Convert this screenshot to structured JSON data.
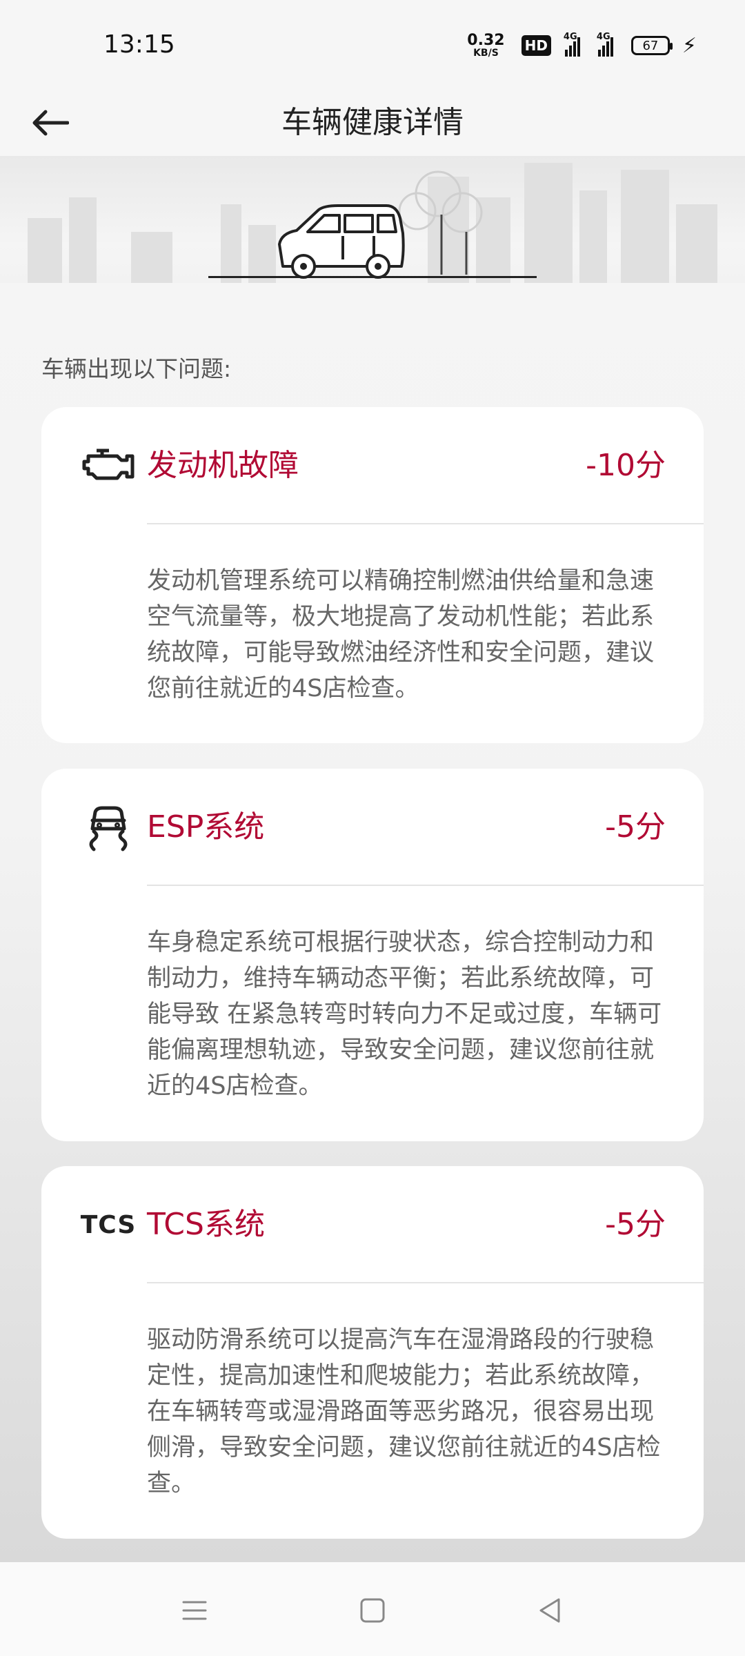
{
  "status_bar": {
    "time": "13:15",
    "net_speed": "0.32",
    "net_unit": "KB/S",
    "hd_label": "HD",
    "signal1_label": "4G",
    "signal2_label": "4G",
    "battery": "67"
  },
  "header": {
    "title": "车辆健康详情",
    "back_icon": "arrow-left-icon"
  },
  "section": {
    "title": "车辆出现以下问题:"
  },
  "cards": [
    {
      "icon": "engine-warning-icon",
      "title": "发动机故障",
      "score": "-10分",
      "description": "发动机管理系统可以精确控制燃油供给量和急速空气流量等，极大地提高了发动机性能；若此系统故障，可能导致燃油经济性和安全问题，建议您前往就近的4S店检查。"
    },
    {
      "icon": "esp-skid-icon",
      "title": "ESP系统",
      "score": "-5分",
      "description": "车身稳定系统可根据行驶状态，综合控制动力和制动力，维持车辆动态平衡；若此系统故障，可能导致 在紧急转弯时转向力不足或过度，车辆可能偏离理想轨迹，导致安全问题，建议您前往就近的4S店检查。"
    },
    {
      "icon": "tcs-text-icon",
      "icon_text": "TCS",
      "title": "TCS系统",
      "score": "-5分",
      "description": "驱动防滑系统可以提高汽车在湿滑路段的行驶稳定性，提高加速性和爬坡能力；若此系统故障，在车辆转弯或湿滑路面等恶劣路况，很容易出现侧滑，导致安全问题，建议您前往就近的4S店检查。"
    }
  ],
  "nav": {
    "menu_icon": "menu-icon",
    "home_icon": "home-square-icon",
    "back_icon": "back-triangle-icon"
  }
}
